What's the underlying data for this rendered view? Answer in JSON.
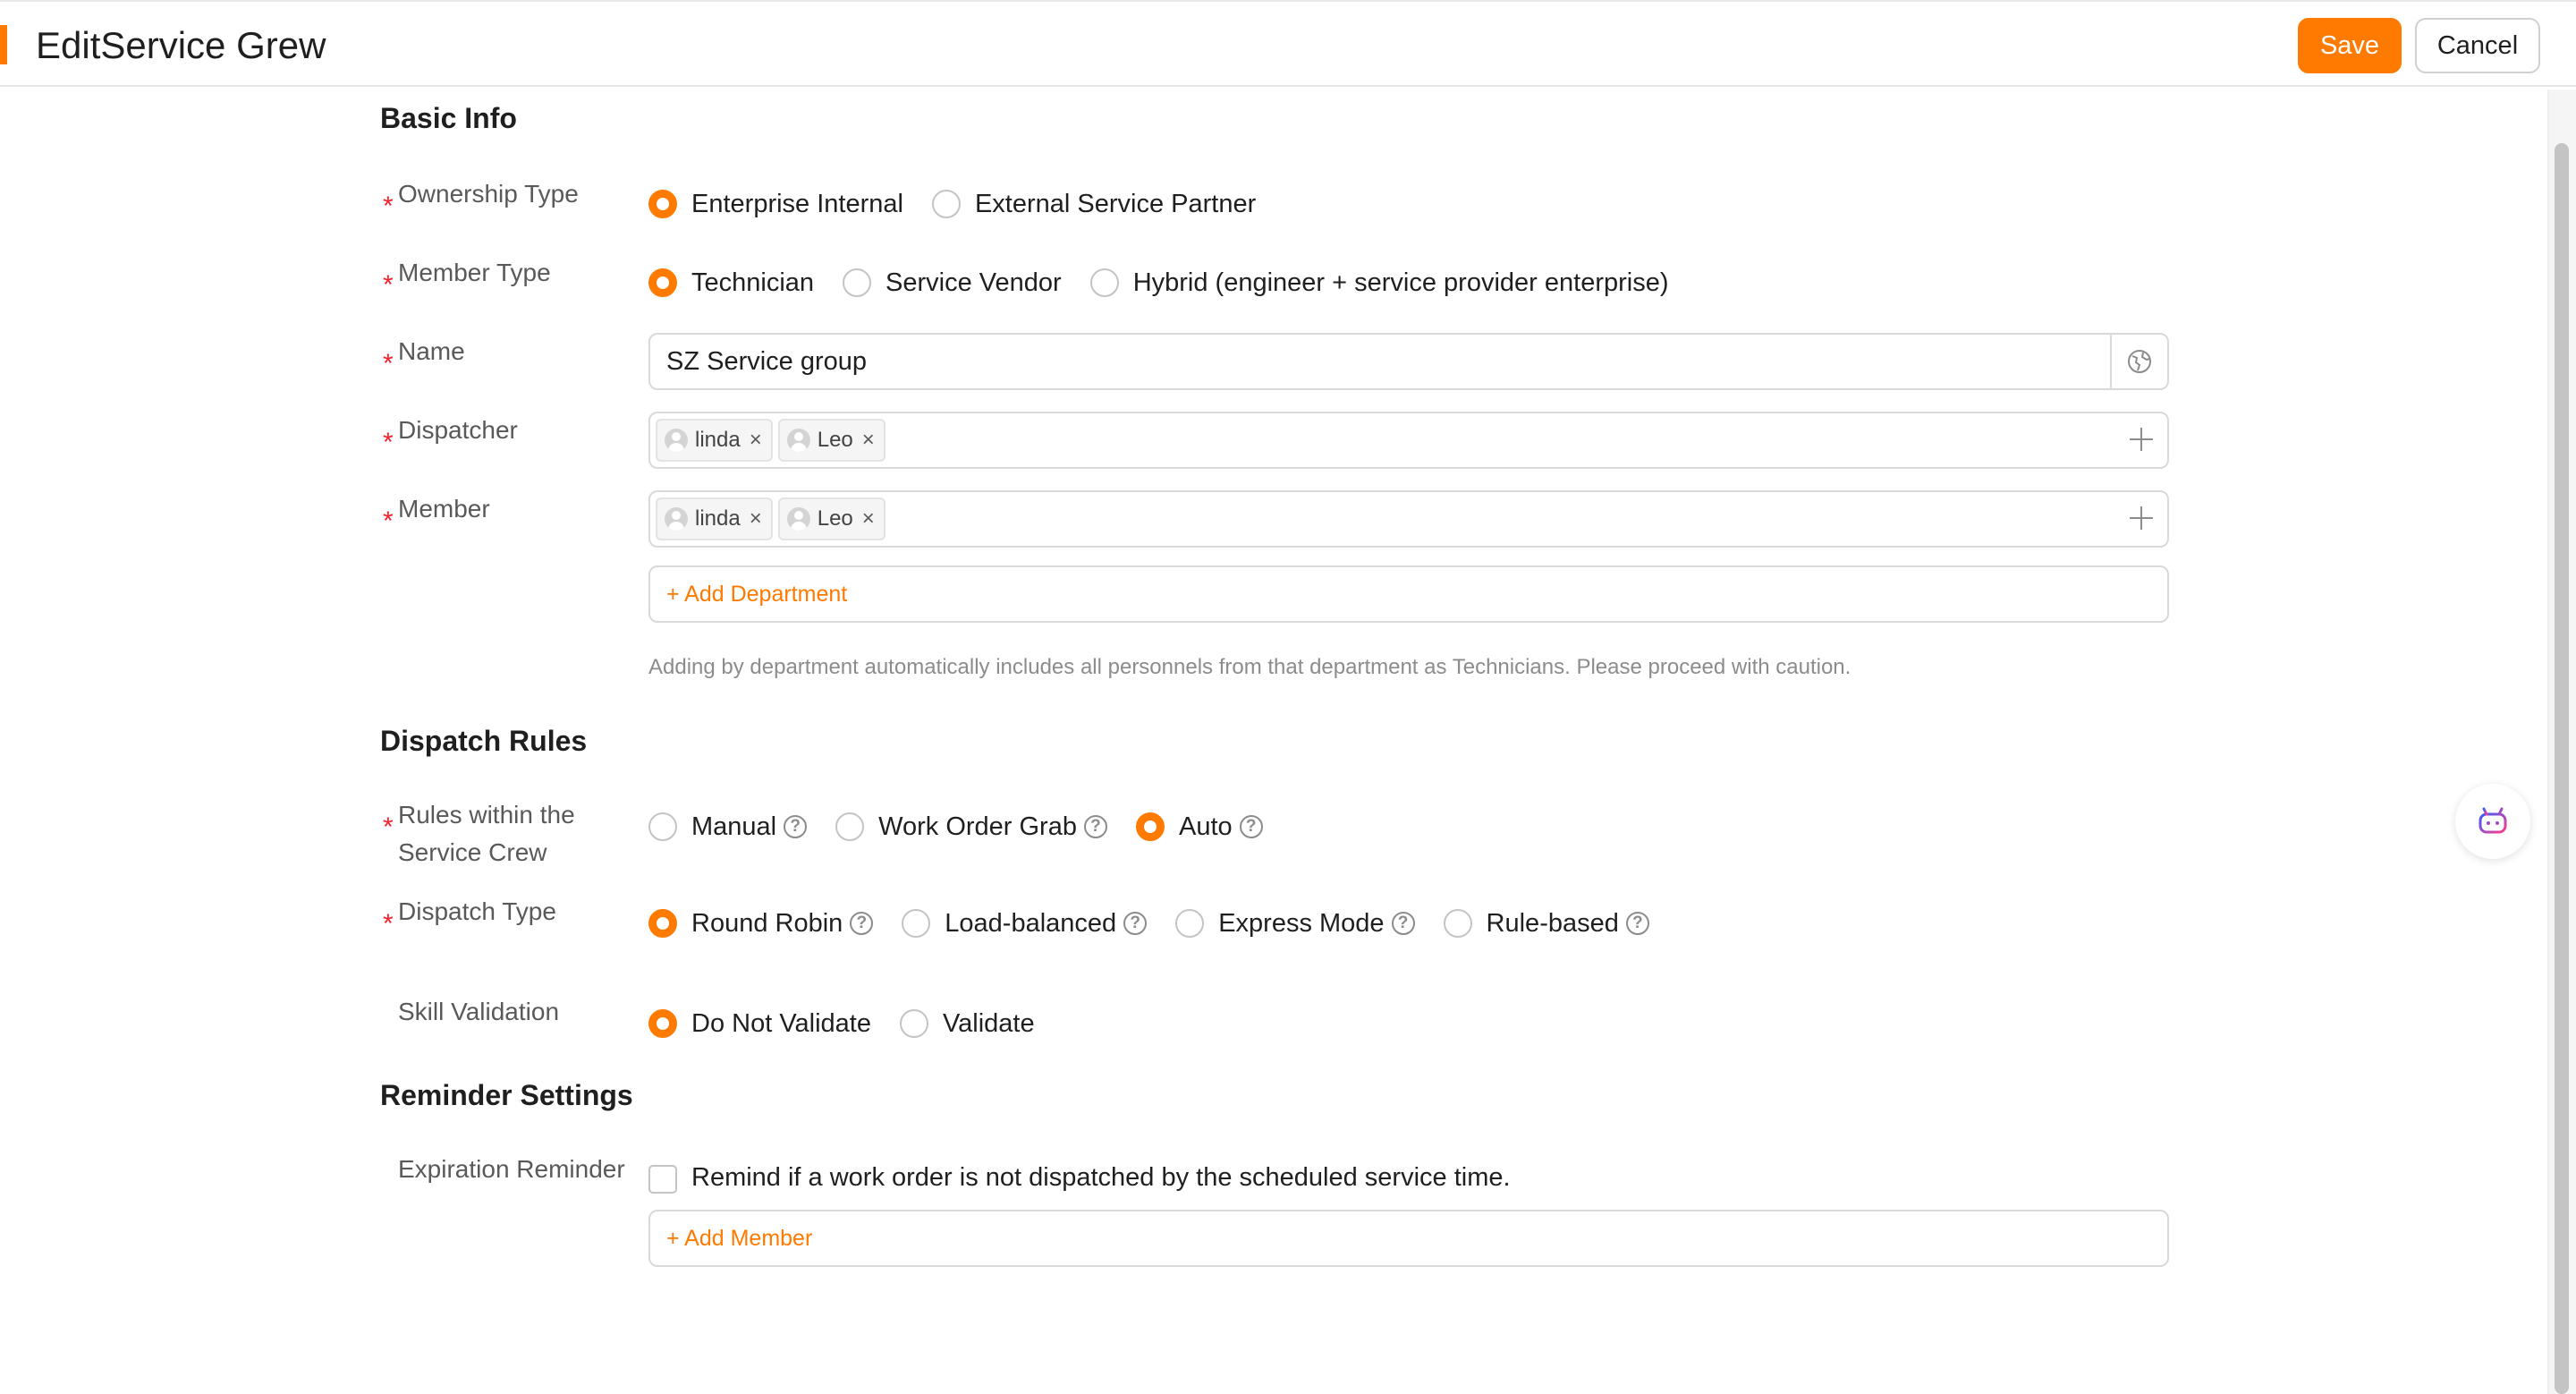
{
  "header": {
    "title": "EditService Grew",
    "save_label": "Save",
    "cancel_label": "Cancel",
    "accent_color": "#ff7a00"
  },
  "basic_info": {
    "section_title": "Basic Info",
    "ownership_type": {
      "label": "Ownership Type",
      "options": [
        "Enterprise Internal",
        "External Service Partner"
      ],
      "selected": "Enterprise Internal"
    },
    "member_type": {
      "label": "Member Type",
      "options": [
        "Technician",
        "Service Vendor",
        "Hybrid (engineer + service provider enterprise)"
      ],
      "selected": "Technician"
    },
    "name": {
      "label": "Name",
      "value": "SZ Service group",
      "suffix_icon": "globe-icon"
    },
    "dispatcher": {
      "label": "Dispatcher",
      "tags": [
        "linda",
        "Leo"
      ]
    },
    "member": {
      "label": "Member",
      "tags": [
        "linda",
        "Leo"
      ],
      "add_department": "+ Add Department",
      "hint": "Adding by department automatically includes all personnels from that department as Technicians. Please proceed with caution."
    }
  },
  "dispatch_rules": {
    "section_title": "Dispatch Rules",
    "rules_within": {
      "label_line1": "Rules within the",
      "label_line2": "Service Crew",
      "options": [
        "Manual",
        "Work Order Grab",
        "Auto"
      ],
      "selected": "Auto"
    },
    "dispatch_type": {
      "label": "Dispatch Type",
      "options": [
        "Round Robin",
        "Load-balanced",
        "Express Mode",
        "Rule-based"
      ],
      "selected": "Round Robin"
    },
    "skill_validation": {
      "label": "Skill Validation",
      "options": [
        "Do Not Validate",
        "Validate"
      ],
      "selected": "Do Not Validate"
    }
  },
  "reminder_settings": {
    "section_title": "Reminder Settings",
    "expiration_reminder": {
      "label": "Expiration Reminder",
      "checkbox_text": "Remind if a work order is not dispatched by the scheduled service time.",
      "checked": false,
      "add_member": "+ Add Member"
    }
  },
  "required_mark": "*",
  "help_glyph": "?",
  "close_glyph": "×"
}
